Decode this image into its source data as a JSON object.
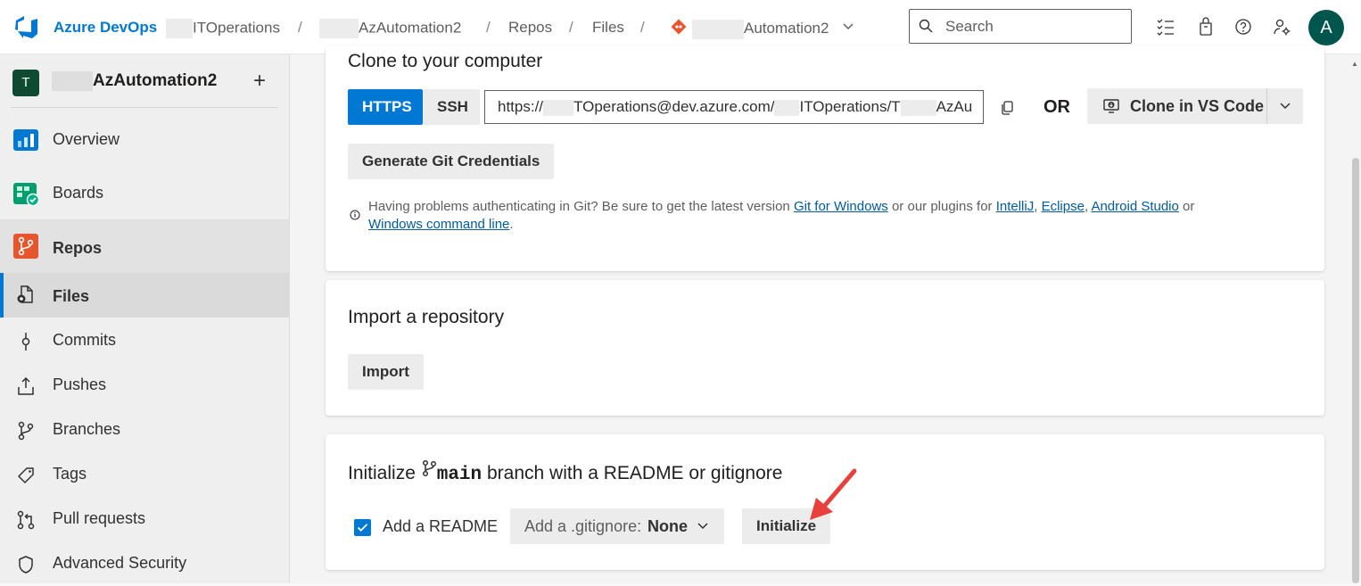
{
  "header": {
    "brand": "Azure DevOps",
    "breadcrumbs": {
      "org": "ITOperations",
      "project": "AzAutomation2",
      "repos": "Repos",
      "files": "Files",
      "repo": "Automation2"
    },
    "separator": "/",
    "search_placeholder": "Search",
    "avatar_initial": "A"
  },
  "sidebar": {
    "project_initial": "T",
    "project_name": "AzAutomation2",
    "add_symbol": "+",
    "items": [
      {
        "label": "Overview",
        "icon": "overview-icon"
      },
      {
        "label": "Boards",
        "icon": "boards-icon"
      },
      {
        "label": "Repos",
        "icon": "repos-icon"
      },
      {
        "label": "Files",
        "icon": "files-icon"
      },
      {
        "label": "Commits",
        "icon": "commits-icon"
      },
      {
        "label": "Pushes",
        "icon": "pushes-icon"
      },
      {
        "label": "Branches",
        "icon": "branches-icon"
      },
      {
        "label": "Tags",
        "icon": "tags-icon"
      },
      {
        "label": "Pull requests",
        "icon": "pull-requests-icon"
      },
      {
        "label": "Advanced Security",
        "icon": "shield-icon"
      }
    ]
  },
  "clone": {
    "title": "Clone to your computer",
    "https_label": "HTTPS",
    "ssh_label": "SSH",
    "url_part1": "https://",
    "url_part2": "TOperations@dev.azure.com/",
    "url_part3": "ITOperations/T",
    "url_part4": "AzAu",
    "or_label": "OR",
    "clone_vscode_label": "Clone in VS Code",
    "git_credentials_label": "Generate Git Credentials",
    "help_text_1": "Having problems authenticating in Git? Be sure to get the latest version",
    "help_link_git_windows": "Git for Windows",
    "help_text_2": "or our plugins for",
    "help_link_intellij": "IntelliJ",
    "help_link_eclipse": "Eclipse",
    "help_link_android": "Android Studio",
    "help_text_3": "or",
    "help_link_cmdline": "Windows command line",
    "comma": ",",
    "period": "."
  },
  "import": {
    "title": "Import a repository",
    "button_label": "Import"
  },
  "initialize": {
    "title_prefix": "Initialize",
    "branch_name": "main",
    "title_suffix": "branch with a README or gitignore",
    "readme_label": "Add a README",
    "readme_checked": true,
    "gitignore_label": "Add a .gitignore:",
    "gitignore_value": "None",
    "button_label": "Initialize"
  },
  "colors": {
    "accent": "#0078d4",
    "avatar": "#00564d",
    "project_badge": "#0e4a32",
    "git_repo": "#e8552d",
    "arrow": "#e8403c"
  }
}
